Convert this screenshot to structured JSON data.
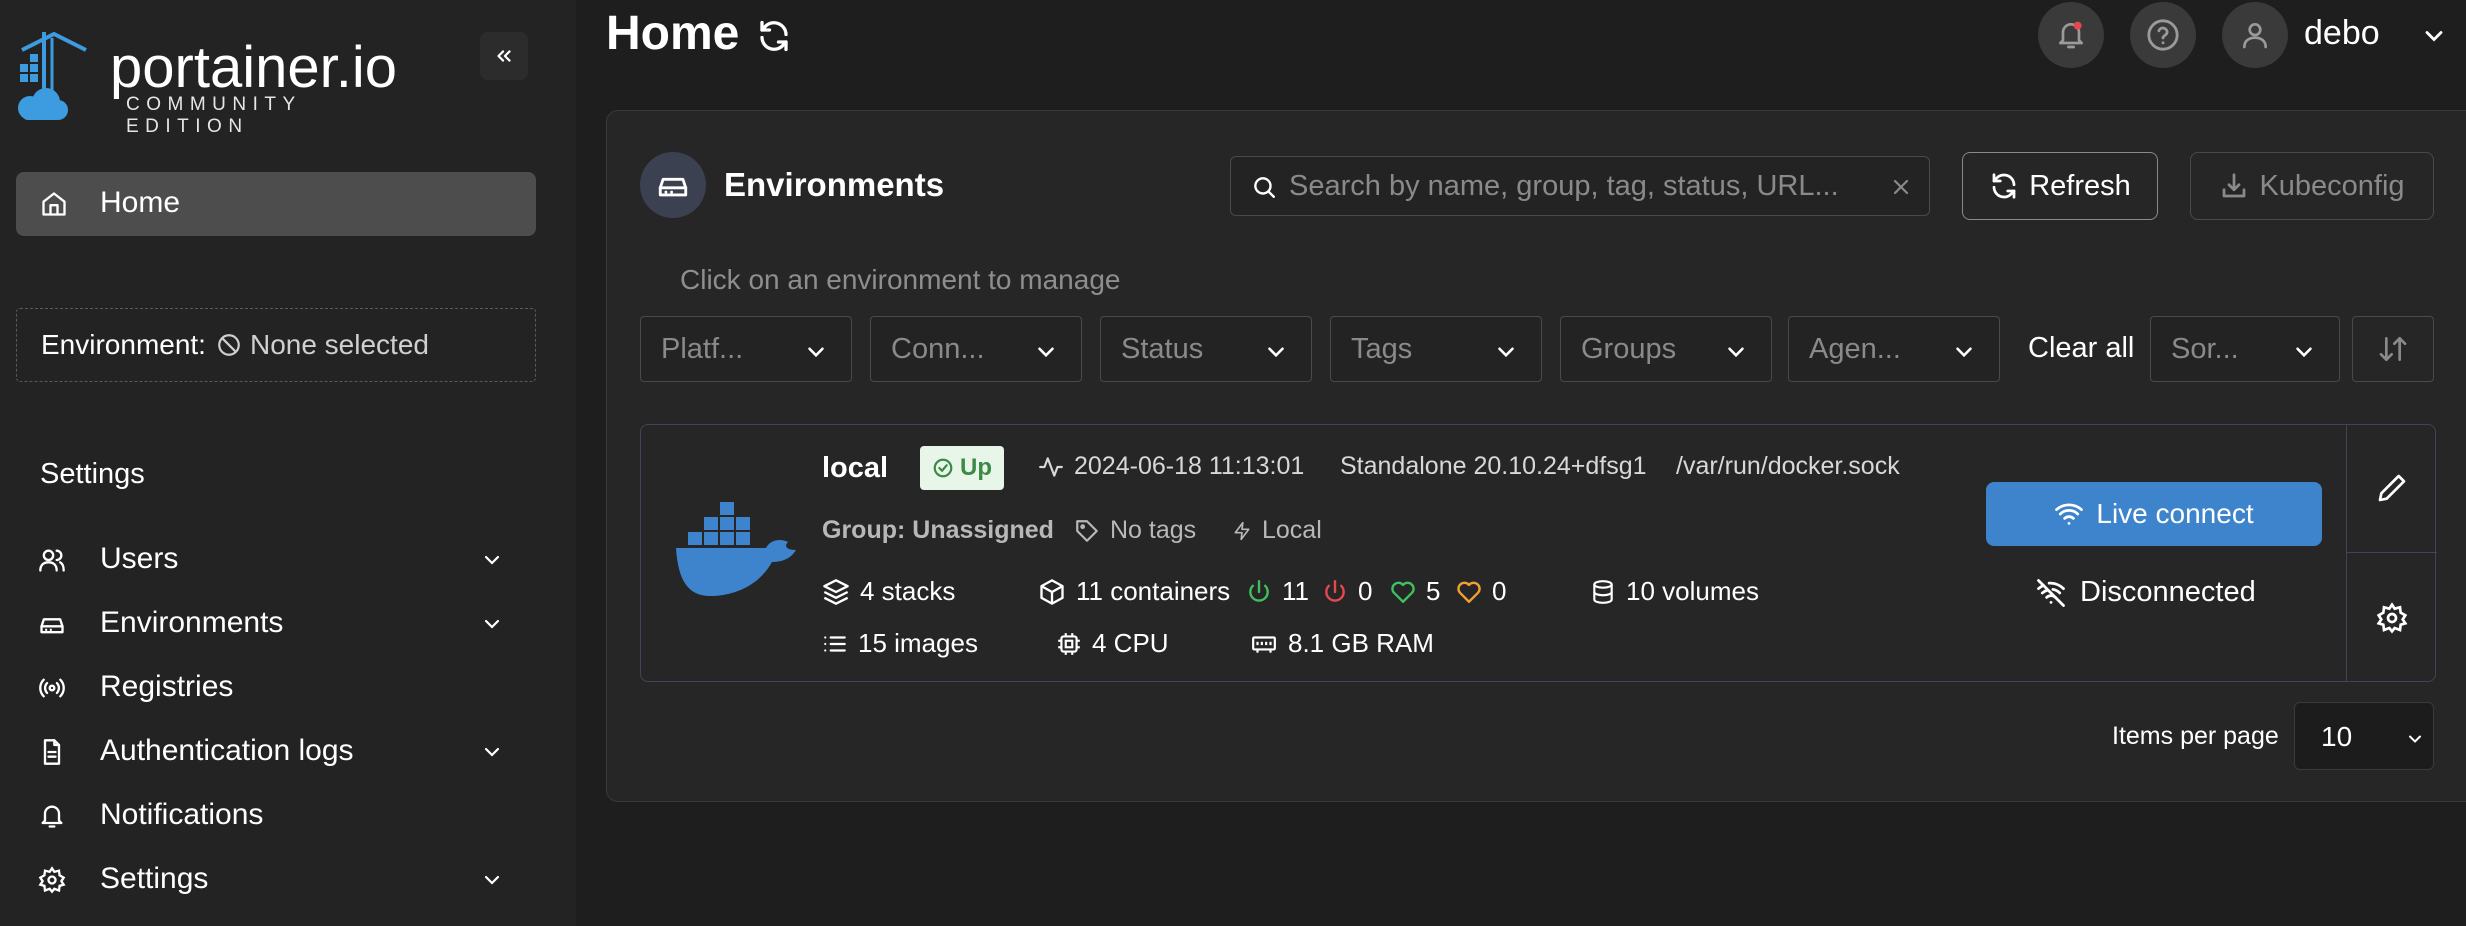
{
  "sidebar": {
    "logo_text": "portainer.io",
    "logo_sub": "COMMUNITY EDITION",
    "home_label": "Home",
    "environment_key": "Environment:",
    "environment_value": "None selected",
    "settings_section": "Settings",
    "items": [
      {
        "label": "Users",
        "icon": "users-icon",
        "expandable": true
      },
      {
        "label": "Environments",
        "icon": "hard-drive-icon",
        "expandable": true
      },
      {
        "label": "Registries",
        "icon": "radio-icon",
        "expandable": false
      },
      {
        "label": "Authentication logs",
        "icon": "file-text-icon",
        "expandable": true
      },
      {
        "label": "Notifications",
        "icon": "bell-icon",
        "expandable": false
      },
      {
        "label": "Settings",
        "icon": "gear-icon",
        "expandable": true
      }
    ]
  },
  "header": {
    "title": "Home",
    "username": "debo"
  },
  "environments": {
    "title": "Environments",
    "search_placeholder": "Search by name, group, tag, status, URL...",
    "refresh_label": "Refresh",
    "kubeconfig_label": "Kubeconfig",
    "hint": "Click on an environment to manage",
    "filters": [
      "Platf...",
      "Conn...",
      "Status",
      "Tags",
      "Groups",
      "Agen..."
    ],
    "clear_all": "Clear all",
    "sort_placeholder": "Sor...",
    "items_per_page_label": "Items per page",
    "items_per_page_value": "10"
  },
  "env_card": {
    "name": "local",
    "status": "Up",
    "timestamp": "2024-06-18 11:13:01",
    "type": "Standalone 20.10.24+dfsg1",
    "socket": "/var/run/docker.sock",
    "group": "Group: Unassigned",
    "tags": "No tags",
    "location": "Local",
    "stacks": "4 stacks",
    "containers": "11 containers",
    "running": "11",
    "stopped": "0",
    "healthy": "5",
    "unhealthy": "0",
    "volumes": "10 volumes",
    "images": "15 images",
    "cpu": "4 CPU",
    "ram": "8.1 GB RAM",
    "live_connect": "Live connect",
    "disconnected": "Disconnected"
  },
  "colors": {
    "accent_blue": "#3d84cc",
    "up_green": "#3b8a45",
    "running_green": "#3fbf5f",
    "stopped_red": "#e5484d",
    "unhealthy_orange": "#f0a030"
  }
}
